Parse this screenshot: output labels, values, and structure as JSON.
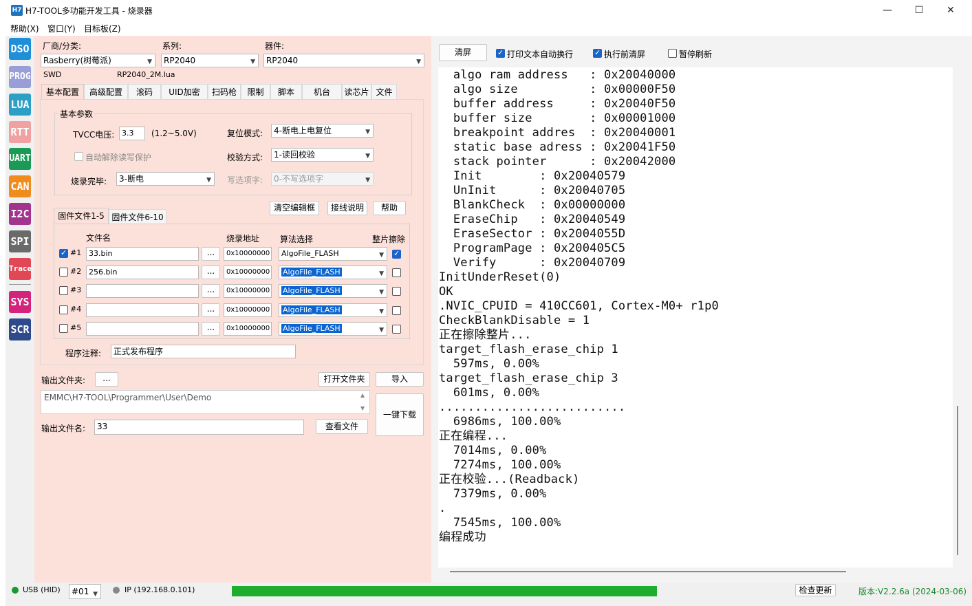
{
  "window": {
    "app_icon_text": "H7",
    "title": "H7-TOOL多功能开发工具 - 烧录器",
    "minimize": "—",
    "maximize": "☐",
    "close": "✕"
  },
  "menu": [
    "帮助(X)",
    "窗口(Y)",
    "目标板(Z)"
  ],
  "toolbar": [
    {
      "label": "DSO",
      "color": "#1f8fd8"
    },
    {
      "label": "PROG",
      "color": "#9a9ed6"
    },
    {
      "label": "LUA",
      "color": "#2d9fc4"
    },
    {
      "label": "RTT",
      "color": "#f0a2a2"
    },
    {
      "label": "UART",
      "color": "#1a9a56"
    },
    {
      "label": "CAN",
      "color": "#f08c1e"
    },
    {
      "label": "I2C",
      "color": "#a2348e"
    },
    {
      "label": "SPI",
      "color": "#6a6a6a"
    },
    {
      "label": "Trace",
      "color": "#e04856"
    },
    {
      "label": "SYS",
      "color": "#d4237a"
    },
    {
      "label": "SCR",
      "color": "#2e4a8a"
    }
  ],
  "device": {
    "vendor_label": "厂商/分类:",
    "vendor_value": "Rasberry(树莓派)",
    "series_label": "系列:",
    "series_value": "RP2040",
    "chip_label": "器件:",
    "chip_value": "RP2040",
    "interface": "SWD",
    "lua_file": "RP2040_2M.lua"
  },
  "tabs": [
    "基本配置",
    "高级配置",
    "滚码",
    "UID加密",
    "扫码枪",
    "限制",
    "脚本",
    "机台",
    "读芯片",
    "文件"
  ],
  "basic": {
    "group_title": "基本参数",
    "tvcc_label": "TVCC电压:",
    "tvcc_value": "3.3",
    "tvcc_range": "(1.2~5.0V)",
    "reset_label": "复位模式:",
    "reset_value": "4-断电上电复位",
    "auto_unprotect": "自动解除读写保护",
    "verify_label": "校验方式:",
    "verify_value": "1-读回校验",
    "finish_label": "烧录完毕:",
    "finish_value": "3-断电",
    "option_label": "写选项字:",
    "option_value": "0-不写选项字"
  },
  "buttons": {
    "clear_editor": "清空编辑框",
    "wiring": "接线说明",
    "help": "帮助",
    "browse": "...",
    "open_folder": "打开文件夹",
    "import": "导入",
    "view_file": "查看文件",
    "one_click": "一键下载",
    "clear_screen": "清屏",
    "check_update": "检查更新"
  },
  "firmware": {
    "tab1": "固件文件1-5",
    "tab2": "固件文件6-10",
    "col_name": "文件名",
    "col_addr": "烧录地址",
    "col_algo": "算法选择",
    "col_erase": "整片擦除",
    "rows": [
      {
        "id": "#1",
        "checked": true,
        "file": "33.bin",
        "addr": "0x10000000",
        "algo": "AlgoFile_FLASH",
        "highlight": false,
        "erase": true
      },
      {
        "id": "#2",
        "checked": false,
        "file": "256.bin",
        "addr": "0x10000000",
        "algo": "AlgoFile_FLASH",
        "highlight": true,
        "erase": false
      },
      {
        "id": "#3",
        "checked": false,
        "file": "",
        "addr": "0x10000000",
        "algo": "AlgoFile_FLASH",
        "highlight": true,
        "erase": false
      },
      {
        "id": "#4",
        "checked": false,
        "file": "",
        "addr": "0x10000000",
        "algo": "AlgoFile_FLASH",
        "highlight": true,
        "erase": false
      },
      {
        "id": "#5",
        "checked": false,
        "file": "",
        "addr": "0x10000000",
        "algo": "AlgoFile_FLASH",
        "highlight": true,
        "erase": false
      }
    ],
    "note_label": "程序注释:",
    "note_value": "正式发布程序"
  },
  "output": {
    "folder_label": "输出文件夹:",
    "folder_path": "EMMC\\H7-TOOL\\Programmer\\User\\Demo",
    "file_label": "输出文件名:",
    "file_value": "33"
  },
  "console_options": {
    "wrap": "打印文本自动换行",
    "clear_before": "执行前清屏",
    "pause": "暂停刷新"
  },
  "console_lines": [
    "  algo ram address   : 0x20040000",
    "  algo size          : 0x00000F50",
    "  buffer address     : 0x20040F50",
    "  buffer size        : 0x00001000",
    "  breakpoint addres  : 0x20040001",
    "  static base adress : 0x20041F50",
    "  stack pointer      : 0x20042000",
    "  Init        : 0x20040579",
    "  UnInit      : 0x20040705",
    "  BlankCheck  : 0x00000000",
    "  EraseChip   : 0x20040549",
    "  EraseSector : 0x2004055D",
    "  ProgramPage : 0x200405C5",
    "  Verify      : 0x20040709",
    "InitUnderReset(0)",
    "OK",
    ".NVIC_CPUID = 410CC601, Cortex-M0+ r1p0",
    "CheckBlankDisable = 1",
    "正在擦除整片...",
    "target_flash_erase_chip 1",
    "  597ms, 0.00%",
    "target_flash_erase_chip 3",
    "  601ms, 0.00%",
    "..........................",
    "  6986ms, 100.00%",
    "正在编程...",
    "  7014ms, 0.00%",
    "  7274ms, 100.00%",
    "正在校验...(Readback)",
    "  7379ms, 0.00%",
    ".",
    "  7545ms, 100.00%",
    "编程成功"
  ],
  "status": {
    "usb": "USB (HID)",
    "device_id": "#01",
    "ip": "IP (192.168.0.101)",
    "progress": 1.0,
    "version": "版本:V2.2.6a (2024-03-06)",
    "color_usb": "#1a9a2e",
    "color_progress": "#1fad2e",
    "color_version": "#1a8a2a"
  }
}
